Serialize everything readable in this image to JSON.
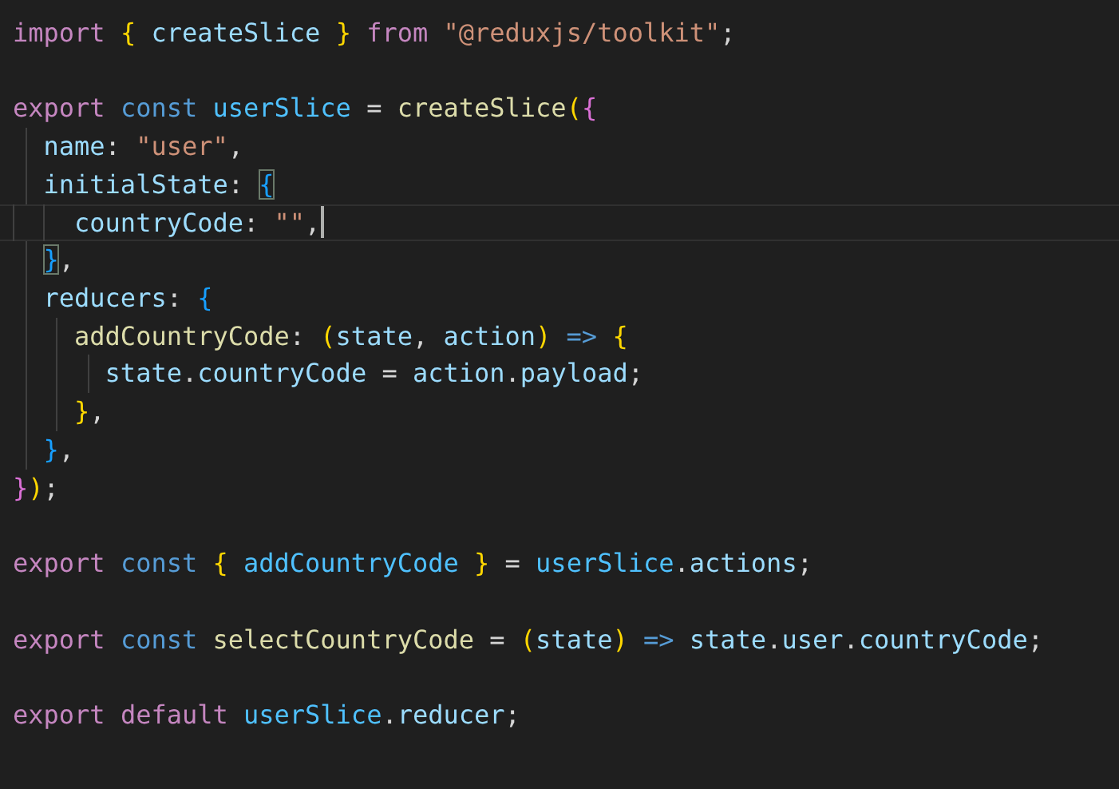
{
  "editor": {
    "lines": [
      {
        "kind": "code",
        "cursor": false,
        "tokens": [
          {
            "text": "import ",
            "kind": "keyword"
          },
          {
            "text": "{",
            "kind": "bracket1"
          },
          {
            "text": " createSlice ",
            "kind": "variable"
          },
          {
            "text": "} ",
            "kind": "bracket1"
          },
          {
            "text": "from ",
            "kind": "keyword"
          },
          {
            "text": "\"@reduxjs/toolkit\"",
            "kind": "string"
          },
          {
            "text": ";",
            "kind": "plain"
          }
        ]
      },
      {
        "kind": "blank"
      },
      {
        "kind": "code",
        "cursor": false,
        "tokens": [
          {
            "text": "export ",
            "kind": "keyword"
          },
          {
            "text": "const ",
            "kind": "storage"
          },
          {
            "text": "userSlice",
            "kind": "constant"
          },
          {
            "text": " = ",
            "kind": "plain"
          },
          {
            "text": "createSlice",
            "kind": "function"
          },
          {
            "text": "(",
            "kind": "bracket1"
          },
          {
            "text": "{",
            "kind": "bracket2"
          }
        ]
      },
      {
        "kind": "code",
        "cursor": false,
        "tokens": [
          {
            "text": "  name",
            "kind": "property"
          },
          {
            "text": ": ",
            "kind": "plain"
          },
          {
            "text": "\"user\"",
            "kind": "string"
          },
          {
            "text": ",",
            "kind": "plain"
          }
        ]
      },
      {
        "kind": "code",
        "cursor": false,
        "tokens": [
          {
            "text": "  initialState",
            "kind": "property"
          },
          {
            "text": ": ",
            "kind": "plain"
          },
          {
            "text": "{",
            "kind": "bracket3-matched"
          }
        ]
      },
      {
        "kind": "code",
        "cursor": true,
        "tokens": [
          {
            "text": "    countryCode",
            "kind": "property"
          },
          {
            "text": ": ",
            "kind": "plain"
          },
          {
            "text": "\"\"",
            "kind": "string"
          },
          {
            "text": ",",
            "kind": "plain"
          }
        ]
      },
      {
        "kind": "code",
        "cursor": false,
        "tokens": [
          {
            "text": "  }",
            "kind": "bracket3-matched"
          },
          {
            "text": ",",
            "kind": "plain"
          }
        ]
      },
      {
        "kind": "code",
        "cursor": false,
        "tokens": [
          {
            "text": "  reducers",
            "kind": "property"
          },
          {
            "text": ": ",
            "kind": "plain"
          },
          {
            "text": "{",
            "kind": "bracket3"
          }
        ]
      },
      {
        "kind": "code",
        "cursor": false,
        "tokens": [
          {
            "text": "    addCountryCode",
            "kind": "function"
          },
          {
            "text": ": ",
            "kind": "plain"
          },
          {
            "text": "(",
            "kind": "bracket1"
          },
          {
            "text": "state",
            "kind": "variable"
          },
          {
            "text": ", ",
            "kind": "plain"
          },
          {
            "text": "action",
            "kind": "variable"
          },
          {
            "text": ") ",
            "kind": "bracket1"
          },
          {
            "text": "=> ",
            "kind": "storage"
          },
          {
            "text": "{",
            "kind": "bracket1"
          }
        ]
      },
      {
        "kind": "code",
        "cursor": false,
        "tokens": [
          {
            "text": "      state",
            "kind": "variable"
          },
          {
            "text": ".",
            "kind": "plain"
          },
          {
            "text": "countryCode",
            "kind": "property"
          },
          {
            "text": " = ",
            "kind": "plain"
          },
          {
            "text": "action",
            "kind": "variable"
          },
          {
            "text": ".",
            "kind": "plain"
          },
          {
            "text": "payload",
            "kind": "property"
          },
          {
            "text": ";",
            "kind": "plain"
          }
        ]
      },
      {
        "kind": "code",
        "cursor": false,
        "tokens": [
          {
            "text": "    }",
            "kind": "bracket1"
          },
          {
            "text": ",",
            "kind": "plain"
          }
        ]
      },
      {
        "kind": "code",
        "cursor": false,
        "tokens": [
          {
            "text": "  }",
            "kind": "bracket3"
          },
          {
            "text": ",",
            "kind": "plain"
          }
        ]
      },
      {
        "kind": "code",
        "cursor": false,
        "tokens": [
          {
            "text": "}",
            "kind": "bracket2"
          },
          {
            "text": ")",
            "kind": "bracket1"
          },
          {
            "text": ";",
            "kind": "plain"
          }
        ]
      },
      {
        "kind": "blank"
      },
      {
        "kind": "code",
        "cursor": false,
        "tokens": [
          {
            "text": "export ",
            "kind": "keyword"
          },
          {
            "text": "const ",
            "kind": "storage"
          },
          {
            "text": "{ ",
            "kind": "bracket1"
          },
          {
            "text": "addCountryCode ",
            "kind": "constant"
          },
          {
            "text": "}",
            "kind": "bracket1"
          },
          {
            "text": " = ",
            "kind": "plain"
          },
          {
            "text": "userSlice",
            "kind": "constant"
          },
          {
            "text": ".",
            "kind": "plain"
          },
          {
            "text": "actions",
            "kind": "property"
          },
          {
            "text": ";",
            "kind": "plain"
          }
        ]
      },
      {
        "kind": "blank"
      },
      {
        "kind": "code",
        "cursor": false,
        "tokens": [
          {
            "text": "export ",
            "kind": "keyword"
          },
          {
            "text": "const ",
            "kind": "storage"
          },
          {
            "text": "selectCountryCode",
            "kind": "function"
          },
          {
            "text": " = ",
            "kind": "plain"
          },
          {
            "text": "(",
            "kind": "bracket1"
          },
          {
            "text": "state",
            "kind": "variable"
          },
          {
            "text": ") ",
            "kind": "bracket1"
          },
          {
            "text": "=> ",
            "kind": "storage"
          },
          {
            "text": "state",
            "kind": "variable"
          },
          {
            "text": ".",
            "kind": "plain"
          },
          {
            "text": "user",
            "kind": "property"
          },
          {
            "text": ".",
            "kind": "plain"
          },
          {
            "text": "countryCode",
            "kind": "property"
          },
          {
            "text": ";",
            "kind": "plain"
          }
        ]
      },
      {
        "kind": "blank"
      },
      {
        "kind": "code",
        "cursor": false,
        "tokens": [
          {
            "text": "export ",
            "kind": "keyword"
          },
          {
            "text": "default ",
            "kind": "keyword"
          },
          {
            "text": "userSlice",
            "kind": "constant"
          },
          {
            "text": ".",
            "kind": "plain"
          },
          {
            "text": "reducer",
            "kind": "property"
          },
          {
            "text": ";",
            "kind": "plain"
          }
        ]
      }
    ]
  }
}
